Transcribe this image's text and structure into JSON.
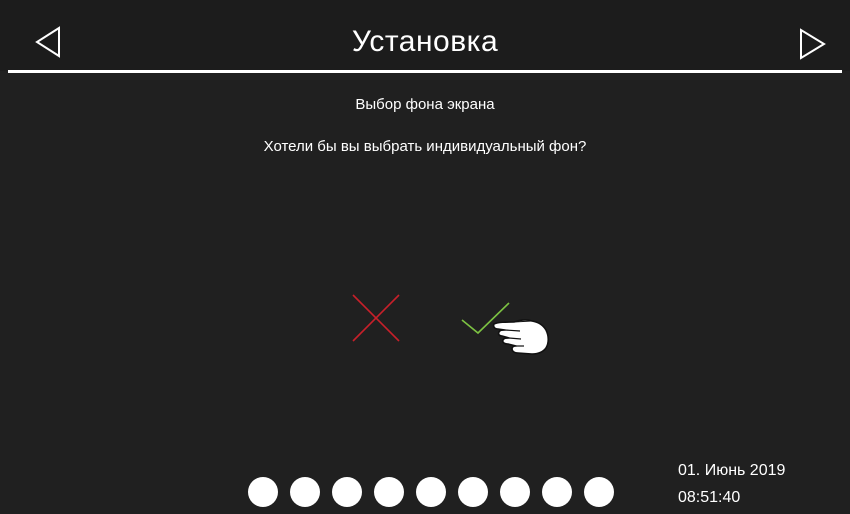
{
  "header": {
    "title": "Установка",
    "back_icon": "triangle-left-icon",
    "forward_icon": "triangle-right-icon"
  },
  "content": {
    "subtitle": "Выбор фона экрана",
    "question": "Хотели бы вы выбрать индивидуальный фон?"
  },
  "choices": {
    "no_icon": "cross-icon",
    "no_color": "#c8202a",
    "yes_icon": "checkmark-icon",
    "yes_color": "#7cc242",
    "pointer_icon": "pointing-hand-icon"
  },
  "pagination": {
    "total": 9,
    "dot_color": "#ffffff"
  },
  "status": {
    "date": "01. Июнь 2019",
    "time": "08:51:40"
  },
  "colors": {
    "background": "#202020",
    "text": "#ffffff"
  }
}
